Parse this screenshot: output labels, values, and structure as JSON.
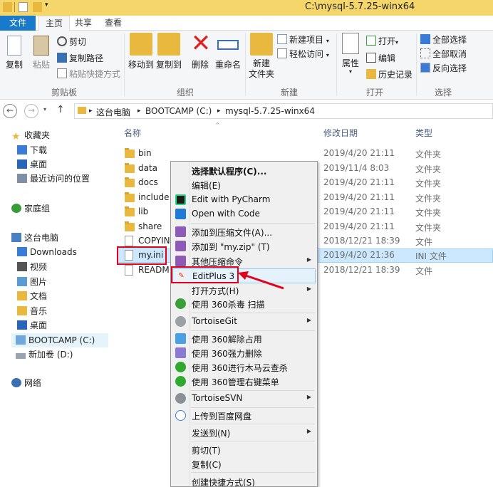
{
  "window": {
    "title": "C:\\mysql-5.7.25-winx64"
  },
  "tabs": [
    "文件",
    "主页",
    "共享",
    "查看"
  ],
  "ribbon": {
    "clipboard": {
      "label": "剪贴板",
      "copy": "复制",
      "paste": "粘贴",
      "cut": "剪切",
      "copy_path": "复制路径",
      "paste_shortcut": "粘贴快捷方式"
    },
    "organize": {
      "label": "组织",
      "move_to": "移动到",
      "copy_to": "复制到",
      "delete": "删除",
      "rename": "重命名"
    },
    "new": {
      "label": "新建",
      "new_folder": "新建\n文件夹",
      "new_item": "新建项目",
      "easy_access": "轻松访问"
    },
    "open": {
      "label": "打开",
      "properties": "属性",
      "open": "打开",
      "edit": "编辑",
      "history": "历史记录"
    },
    "select": {
      "label": "选择",
      "select_all": "全部选择",
      "select_none": "全部取消",
      "invert": "反向选择"
    }
  },
  "address": {
    "crumbs": [
      "这台电脑",
      "BOOTCAMP (C:)",
      "mysql-5.7.25-winx64"
    ]
  },
  "nav": {
    "items": [
      "收藏夹",
      "下载",
      "桌面",
      "最近访问的位置",
      "家庭组",
      "这台电脑",
      "Downloads",
      "视频",
      "图片",
      "文档",
      "音乐",
      "桌面",
      "BOOTCAMP (C:)",
      "新加卷 (D:)",
      "网络"
    ]
  },
  "columns": {
    "name": "名称",
    "date": "修改日期",
    "type": "类型"
  },
  "files": [
    {
      "name": "bin",
      "date": "2019/4/20 21:11",
      "type": "文件夹"
    },
    {
      "name": "data",
      "date": "2019/11/4 8:03",
      "type": "文件夹"
    },
    {
      "name": "docs",
      "date": "2019/4/20 21:11",
      "type": "文件夹"
    },
    {
      "name": "include",
      "date": "2019/4/20 21:11",
      "type": "文件夹"
    },
    {
      "name": "lib",
      "date": "2019/4/20 21:11",
      "type": "文件夹"
    },
    {
      "name": "share",
      "date": "2019/4/20 21:11",
      "type": "文件夹"
    },
    {
      "name": "COPYIN",
      "date": "2018/12/21 18:39",
      "type": "文件"
    },
    {
      "name": "my.ini",
      "date": "2019/4/20 21:36",
      "type": "INI 文件"
    },
    {
      "name": "READM",
      "date": "2018/12/21 18:39",
      "type": "文件"
    }
  ],
  "context_menu": [
    "选择默认程序(C)...",
    "编辑(E)",
    "Edit with PyCharm",
    "Open with Code",
    "添加到压缩文件(A)...",
    "添加到 \"my.zip\" (T)",
    "其他压缩命令",
    "EditPlus 3",
    "打开方式(H)",
    "使用 360杀毒 扫描",
    "TortoiseGit",
    "使用 360解除占用",
    "使用 360强力删除",
    "使用 360进行木马云查杀",
    "使用 360管理右键菜单",
    "TortoiseSVN",
    "上传到百度网盘",
    "发送到(N)",
    "剪切(T)",
    "复制(C)",
    "创建快捷方式(S)"
  ],
  "colors": {
    "accent": "#1979ca",
    "highlight": "#e3001a",
    "selection": "#cce8ff",
    "folder": "#e8b93e"
  }
}
